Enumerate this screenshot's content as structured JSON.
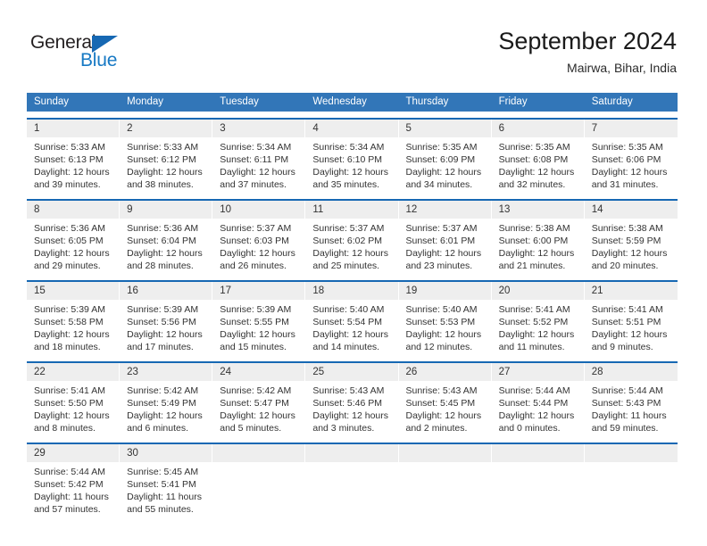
{
  "brand": {
    "name_dark": "General",
    "name_blue": "Blue",
    "triangle_color": "#1668b3"
  },
  "header": {
    "title": "September 2024",
    "location": "Mairwa, Bihar, India"
  },
  "theme": {
    "header_blue": "#3276b8",
    "row_rule_blue": "#1668b3",
    "daynum_band": "#eeeeee",
    "text": "#333333"
  },
  "weekdays": [
    "Sunday",
    "Monday",
    "Tuesday",
    "Wednesday",
    "Thursday",
    "Friday",
    "Saturday"
  ],
  "weeks": [
    [
      {
        "day": "1",
        "sunrise": "Sunrise: 5:33 AM",
        "sunset": "Sunset: 6:13 PM",
        "daylight1": "Daylight: 12 hours",
        "daylight2": "and 39 minutes."
      },
      {
        "day": "2",
        "sunrise": "Sunrise: 5:33 AM",
        "sunset": "Sunset: 6:12 PM",
        "daylight1": "Daylight: 12 hours",
        "daylight2": "and 38 minutes."
      },
      {
        "day": "3",
        "sunrise": "Sunrise: 5:34 AM",
        "sunset": "Sunset: 6:11 PM",
        "daylight1": "Daylight: 12 hours",
        "daylight2": "and 37 minutes."
      },
      {
        "day": "4",
        "sunrise": "Sunrise: 5:34 AM",
        "sunset": "Sunset: 6:10 PM",
        "daylight1": "Daylight: 12 hours",
        "daylight2": "and 35 minutes."
      },
      {
        "day": "5",
        "sunrise": "Sunrise: 5:35 AM",
        "sunset": "Sunset: 6:09 PM",
        "daylight1": "Daylight: 12 hours",
        "daylight2": "and 34 minutes."
      },
      {
        "day": "6",
        "sunrise": "Sunrise: 5:35 AM",
        "sunset": "Sunset: 6:08 PM",
        "daylight1": "Daylight: 12 hours",
        "daylight2": "and 32 minutes."
      },
      {
        "day": "7",
        "sunrise": "Sunrise: 5:35 AM",
        "sunset": "Sunset: 6:06 PM",
        "daylight1": "Daylight: 12 hours",
        "daylight2": "and 31 minutes."
      }
    ],
    [
      {
        "day": "8",
        "sunrise": "Sunrise: 5:36 AM",
        "sunset": "Sunset: 6:05 PM",
        "daylight1": "Daylight: 12 hours",
        "daylight2": "and 29 minutes."
      },
      {
        "day": "9",
        "sunrise": "Sunrise: 5:36 AM",
        "sunset": "Sunset: 6:04 PM",
        "daylight1": "Daylight: 12 hours",
        "daylight2": "and 28 minutes."
      },
      {
        "day": "10",
        "sunrise": "Sunrise: 5:37 AM",
        "sunset": "Sunset: 6:03 PM",
        "daylight1": "Daylight: 12 hours",
        "daylight2": "and 26 minutes."
      },
      {
        "day": "11",
        "sunrise": "Sunrise: 5:37 AM",
        "sunset": "Sunset: 6:02 PM",
        "daylight1": "Daylight: 12 hours",
        "daylight2": "and 25 minutes."
      },
      {
        "day": "12",
        "sunrise": "Sunrise: 5:37 AM",
        "sunset": "Sunset: 6:01 PM",
        "daylight1": "Daylight: 12 hours",
        "daylight2": "and 23 minutes."
      },
      {
        "day": "13",
        "sunrise": "Sunrise: 5:38 AM",
        "sunset": "Sunset: 6:00 PM",
        "daylight1": "Daylight: 12 hours",
        "daylight2": "and 21 minutes."
      },
      {
        "day": "14",
        "sunrise": "Sunrise: 5:38 AM",
        "sunset": "Sunset: 5:59 PM",
        "daylight1": "Daylight: 12 hours",
        "daylight2": "and 20 minutes."
      }
    ],
    [
      {
        "day": "15",
        "sunrise": "Sunrise: 5:39 AM",
        "sunset": "Sunset: 5:58 PM",
        "daylight1": "Daylight: 12 hours",
        "daylight2": "and 18 minutes."
      },
      {
        "day": "16",
        "sunrise": "Sunrise: 5:39 AM",
        "sunset": "Sunset: 5:56 PM",
        "daylight1": "Daylight: 12 hours",
        "daylight2": "and 17 minutes."
      },
      {
        "day": "17",
        "sunrise": "Sunrise: 5:39 AM",
        "sunset": "Sunset: 5:55 PM",
        "daylight1": "Daylight: 12 hours",
        "daylight2": "and 15 minutes."
      },
      {
        "day": "18",
        "sunrise": "Sunrise: 5:40 AM",
        "sunset": "Sunset: 5:54 PM",
        "daylight1": "Daylight: 12 hours",
        "daylight2": "and 14 minutes."
      },
      {
        "day": "19",
        "sunrise": "Sunrise: 5:40 AM",
        "sunset": "Sunset: 5:53 PM",
        "daylight1": "Daylight: 12 hours",
        "daylight2": "and 12 minutes."
      },
      {
        "day": "20",
        "sunrise": "Sunrise: 5:41 AM",
        "sunset": "Sunset: 5:52 PM",
        "daylight1": "Daylight: 12 hours",
        "daylight2": "and 11 minutes."
      },
      {
        "day": "21",
        "sunrise": "Sunrise: 5:41 AM",
        "sunset": "Sunset: 5:51 PM",
        "daylight1": "Daylight: 12 hours",
        "daylight2": "and 9 minutes."
      }
    ],
    [
      {
        "day": "22",
        "sunrise": "Sunrise: 5:41 AM",
        "sunset": "Sunset: 5:50 PM",
        "daylight1": "Daylight: 12 hours",
        "daylight2": "and 8 minutes."
      },
      {
        "day": "23",
        "sunrise": "Sunrise: 5:42 AM",
        "sunset": "Sunset: 5:49 PM",
        "daylight1": "Daylight: 12 hours",
        "daylight2": "and 6 minutes."
      },
      {
        "day": "24",
        "sunrise": "Sunrise: 5:42 AM",
        "sunset": "Sunset: 5:47 PM",
        "daylight1": "Daylight: 12 hours",
        "daylight2": "and 5 minutes."
      },
      {
        "day": "25",
        "sunrise": "Sunrise: 5:43 AM",
        "sunset": "Sunset: 5:46 PM",
        "daylight1": "Daylight: 12 hours",
        "daylight2": "and 3 minutes."
      },
      {
        "day": "26",
        "sunrise": "Sunrise: 5:43 AM",
        "sunset": "Sunset: 5:45 PM",
        "daylight1": "Daylight: 12 hours",
        "daylight2": "and 2 minutes."
      },
      {
        "day": "27",
        "sunrise": "Sunrise: 5:44 AM",
        "sunset": "Sunset: 5:44 PM",
        "daylight1": "Daylight: 12 hours",
        "daylight2": "and 0 minutes."
      },
      {
        "day": "28",
        "sunrise": "Sunrise: 5:44 AM",
        "sunset": "Sunset: 5:43 PM",
        "daylight1": "Daylight: 11 hours",
        "daylight2": "and 59 minutes."
      }
    ],
    [
      {
        "day": "29",
        "sunrise": "Sunrise: 5:44 AM",
        "sunset": "Sunset: 5:42 PM",
        "daylight1": "Daylight: 11 hours",
        "daylight2": "and 57 minutes."
      },
      {
        "day": "30",
        "sunrise": "Sunrise: 5:45 AM",
        "sunset": "Sunset: 5:41 PM",
        "daylight1": "Daylight: 11 hours",
        "daylight2": "and 55 minutes."
      },
      {
        "day": "",
        "sunrise": "",
        "sunset": "",
        "daylight1": "",
        "daylight2": ""
      },
      {
        "day": "",
        "sunrise": "",
        "sunset": "",
        "daylight1": "",
        "daylight2": ""
      },
      {
        "day": "",
        "sunrise": "",
        "sunset": "",
        "daylight1": "",
        "daylight2": ""
      },
      {
        "day": "",
        "sunrise": "",
        "sunset": "",
        "daylight1": "",
        "daylight2": ""
      },
      {
        "day": "",
        "sunrise": "",
        "sunset": "",
        "daylight1": "",
        "daylight2": ""
      }
    ]
  ]
}
